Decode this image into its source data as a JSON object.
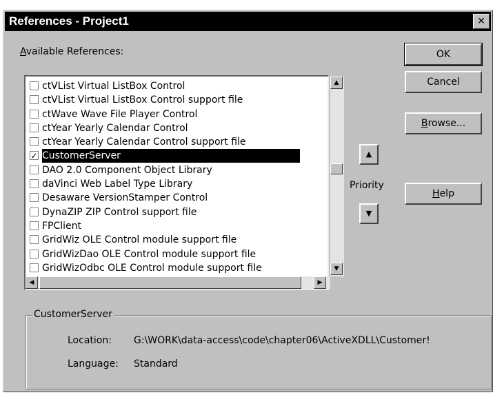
{
  "dialog": {
    "title": "References - Project1",
    "close_glyph": "✕"
  },
  "available_label": "Available References:",
  "available_label_rest": "vailable References:",
  "available_label_hotkey": "A",
  "references": [
    {
      "label": "ctVList Virtual ListBox Control",
      "checked": false,
      "selected": false
    },
    {
      "label": "ctVList Virtual ListBox Control support file",
      "checked": false,
      "selected": false
    },
    {
      "label": "ctWave Wave File Player Control",
      "checked": false,
      "selected": false
    },
    {
      "label": "ctYear Yearly Calendar Control",
      "checked": false,
      "selected": false
    },
    {
      "label": "ctYear Yearly Calendar Control support file",
      "checked": false,
      "selected": false
    },
    {
      "label": "CustomerServer",
      "checked": true,
      "selected": true
    },
    {
      "label": "DAO 2.0 Component Object Library",
      "checked": false,
      "selected": false
    },
    {
      "label": "daVinci Web Label Type Library",
      "checked": false,
      "selected": false
    },
    {
      "label": "Desaware VersionStamper Control",
      "checked": false,
      "selected": false
    },
    {
      "label": "DynaZIP ZIP Control support file",
      "checked": false,
      "selected": false
    },
    {
      "label": "FPClient",
      "checked": false,
      "selected": false
    },
    {
      "label": "GridWiz OLE Control module support file",
      "checked": false,
      "selected": false
    },
    {
      "label": "GridWizDao OLE Control module support file",
      "checked": false,
      "selected": false
    },
    {
      "label": "GridWizOdbc OLE Control module support file",
      "checked": false,
      "selected": false
    }
  ],
  "buttons": {
    "ok": "OK",
    "cancel": "Cancel",
    "browse_hotkey": "B",
    "browse_rest": "rowse...",
    "help_hotkey": "H",
    "help_rest": "elp"
  },
  "priority": {
    "label": "Priority",
    "up_glyph": "▲",
    "down_glyph": "▼"
  },
  "details": {
    "group_title": "CustomerServer",
    "location_label": "Location:",
    "location_value": "G:\\WORK\\data-access\\code\\chapter06\\ActiveXDLL\\Customer!",
    "language_label": "Language:",
    "language_value": "Standard"
  },
  "scroll_glyphs": {
    "up": "▲",
    "down": "▼",
    "left": "◀",
    "right": "▶"
  }
}
